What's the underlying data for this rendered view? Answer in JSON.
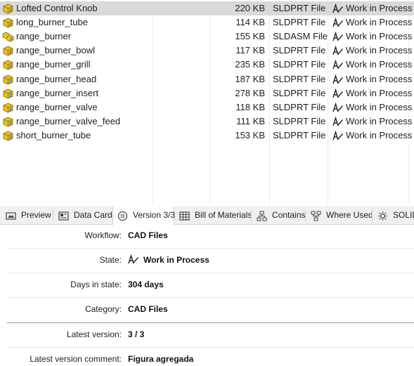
{
  "files": [
    {
      "name": "Lofted Control Knob",
      "size": "220 KB",
      "type": "SLDPRT File",
      "state": "Work in Process",
      "icon": "part-icon",
      "selected": true
    },
    {
      "name": "long_burner_tube",
      "size": "114 KB",
      "type": "SLDPRT File",
      "state": "Work in Process",
      "icon": "part-icon"
    },
    {
      "name": "range_burner",
      "size": "155 KB",
      "type": "SLDASM File",
      "state": "Work in Process",
      "icon": "assembly-icon"
    },
    {
      "name": "range_burner_bowl",
      "size": "117 KB",
      "type": "SLDPRT File",
      "state": "Work in Process",
      "icon": "part-icon"
    },
    {
      "name": "range_burner_grill",
      "size": "235 KB",
      "type": "SLDPRT File",
      "state": "Work in Process",
      "icon": "part-icon"
    },
    {
      "name": "range_burner_head",
      "size": "187 KB",
      "type": "SLDPRT File",
      "state": "Work in Process",
      "icon": "part-icon"
    },
    {
      "name": "range_burner_insert",
      "size": "278 KB",
      "type": "SLDPRT File",
      "state": "Work in Process",
      "icon": "part-icon"
    },
    {
      "name": "range_burner_valve",
      "size": "118 KB",
      "type": "SLDPRT File",
      "state": "Work in Process",
      "icon": "part-icon"
    },
    {
      "name": "range_burner_valve_feed",
      "size": "111 KB",
      "type": "SLDPRT File",
      "state": "Work in Process",
      "icon": "part-icon"
    },
    {
      "name": "short_burner_tube",
      "size": "153 KB",
      "type": "SLDPRT File",
      "state": "Work in Process",
      "icon": "part-icon"
    }
  ],
  "tabs": [
    {
      "label": "Preview",
      "icon": "preview-icon"
    },
    {
      "label": "Data Card",
      "icon": "data-card-icon"
    },
    {
      "label": "Version 3/3",
      "icon": "version-icon",
      "active": true
    },
    {
      "label": "Bill of Materials",
      "icon": "table-icon"
    },
    {
      "label": "Contains",
      "icon": "contains-icon"
    },
    {
      "label": "Where Used",
      "icon": "where-used-icon"
    },
    {
      "label": "SOLID",
      "icon": "solidworks-icon"
    }
  ],
  "properties": {
    "workflow_label": "Workflow:",
    "workflow_value": "CAD Files",
    "state_label": "State:",
    "state_value": "Work in Process",
    "days_label": "Days in state:",
    "days_value": "304 days",
    "category_label": "Category:",
    "category_value": "CAD Files",
    "latest_version_label": "Latest version:",
    "latest_version_value": "3 / 3",
    "comment_label": "Latest version comment:",
    "comment_value": "Figura agregada"
  },
  "colors": {
    "selected_row": "#d9d9d9",
    "part_icon": "#f0c020",
    "state_icon": "#222222"
  }
}
